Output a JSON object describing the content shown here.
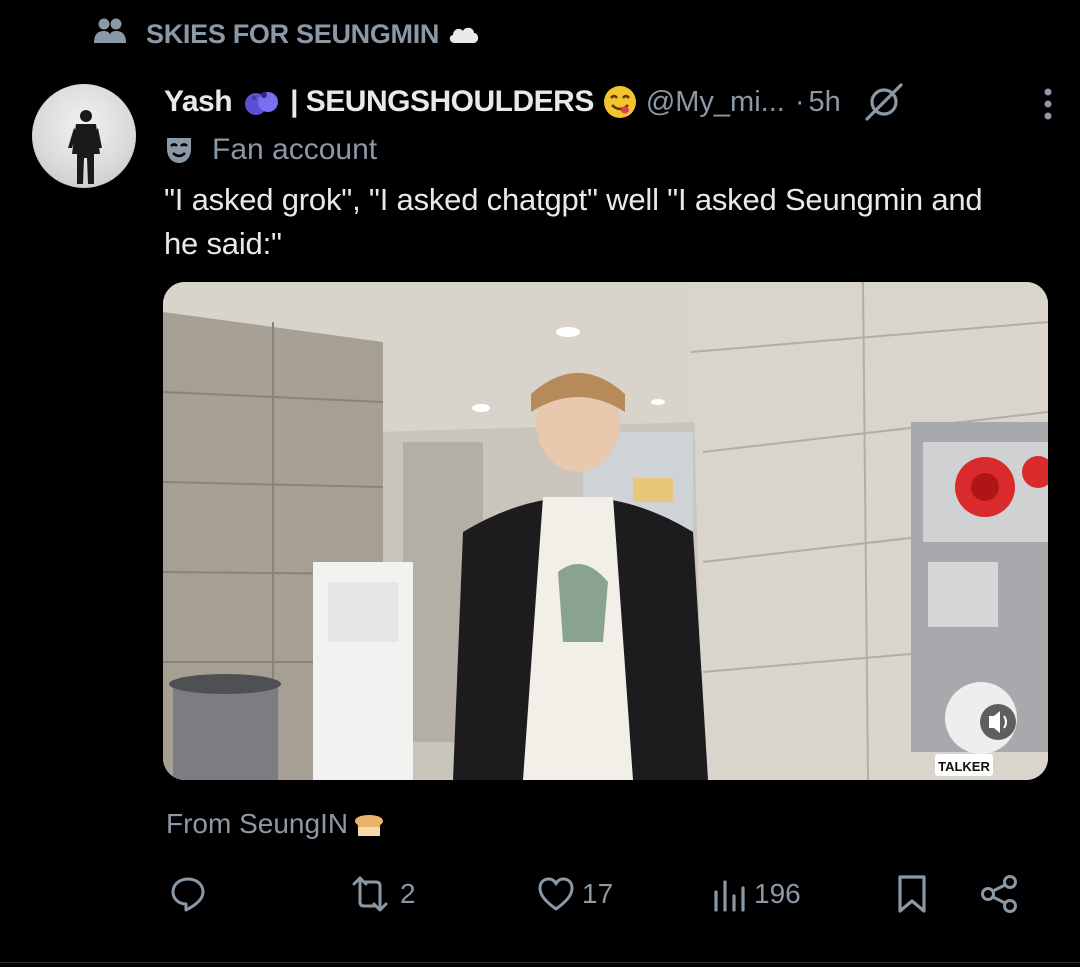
{
  "community": {
    "icon": "community-icon",
    "name": "SKIES FOR SEUNGMIN",
    "emoji": "☁️"
  },
  "post": {
    "author_name_pre": "Yash",
    "author_name_post": "| SEUNGSHOULDERS",
    "handle": "@My_mi...",
    "separator": "·",
    "time": "5h",
    "label": "Fan account",
    "text": "\"I asked grok\", \"I asked chatgpt\" well \"I asked Seungmin and he said:\"",
    "media": {
      "type": "video",
      "watermark": "TALKER"
    },
    "source_prefix": "From SeungIN",
    "source_emoji": "🍞"
  },
  "actions": {
    "replies": "",
    "reposts": "2",
    "likes": "17",
    "views": "196"
  },
  "colors": {
    "background": "#000000",
    "text": "#e7e9ea",
    "muted": "#8b98a5"
  }
}
